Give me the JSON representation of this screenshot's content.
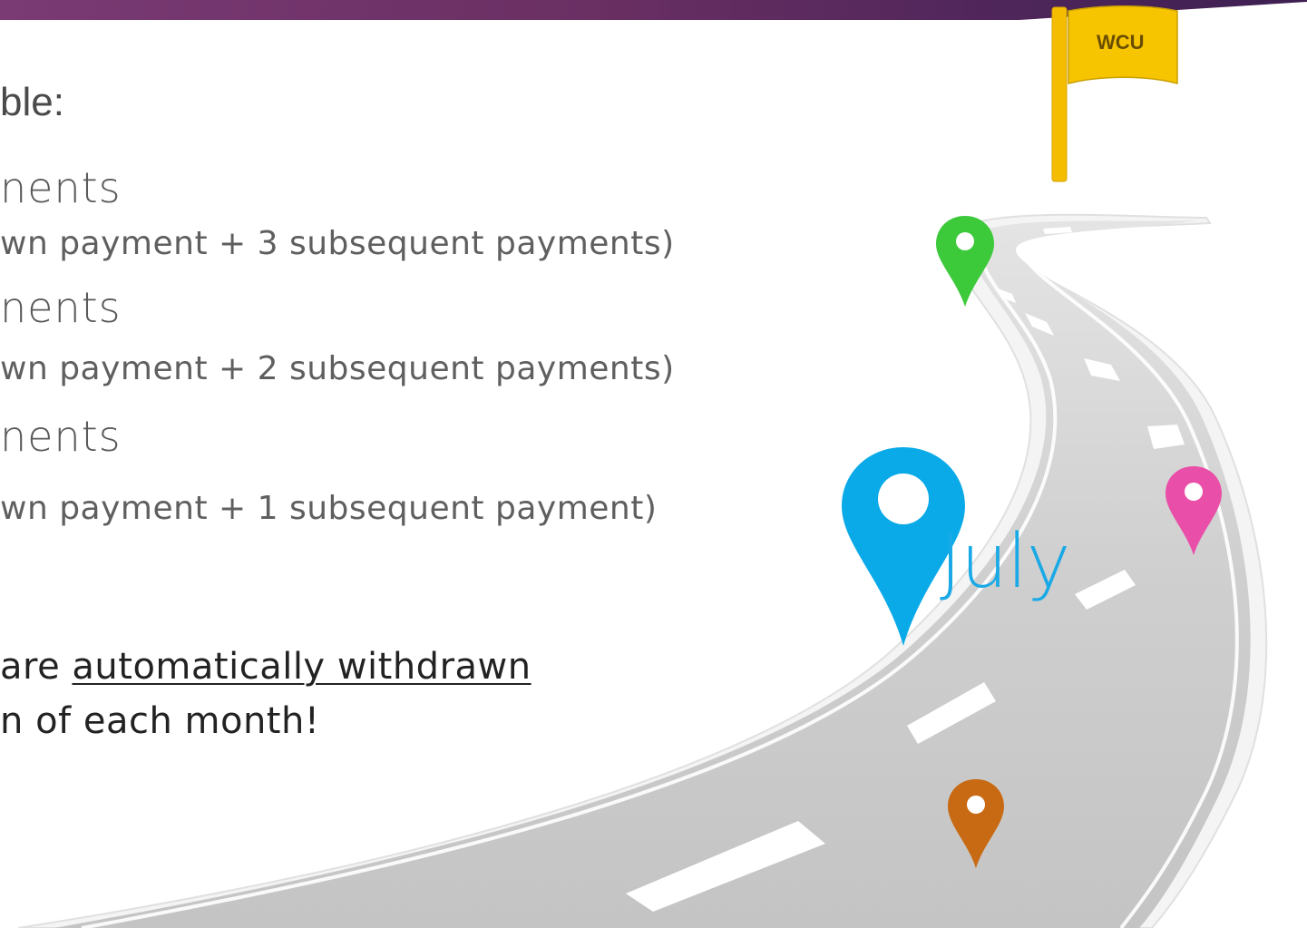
{
  "slide": {
    "heading": "ble:",
    "plans": [
      {
        "label": "nents",
        "detail": "wn payment + 3 subsequent payments)"
      },
      {
        "label": "nents",
        "detail": "wn payment + 2 subsequent payments)"
      },
      {
        "label": "nents",
        "detail": "wn payment + 1 subsequent payment)"
      }
    ],
    "note": {
      "line1_prefix": "are ",
      "line1_link": "automatically withdrawn",
      "line2": "n of each month!"
    }
  },
  "graphic": {
    "flag_label": "WCU",
    "july_label": "July",
    "pins": [
      {
        "name": "green-pin",
        "color": "#3cc93a"
      },
      {
        "name": "blue-pin",
        "color": "#0aaae8"
      },
      {
        "name": "pink-pin",
        "color": "#e94fa8"
      },
      {
        "name": "orange-pin",
        "color": "#c86a14"
      }
    ],
    "colors": {
      "header_bar": "#6a2f63",
      "flag": "#f7c400",
      "road": "#c9c9c9"
    }
  }
}
